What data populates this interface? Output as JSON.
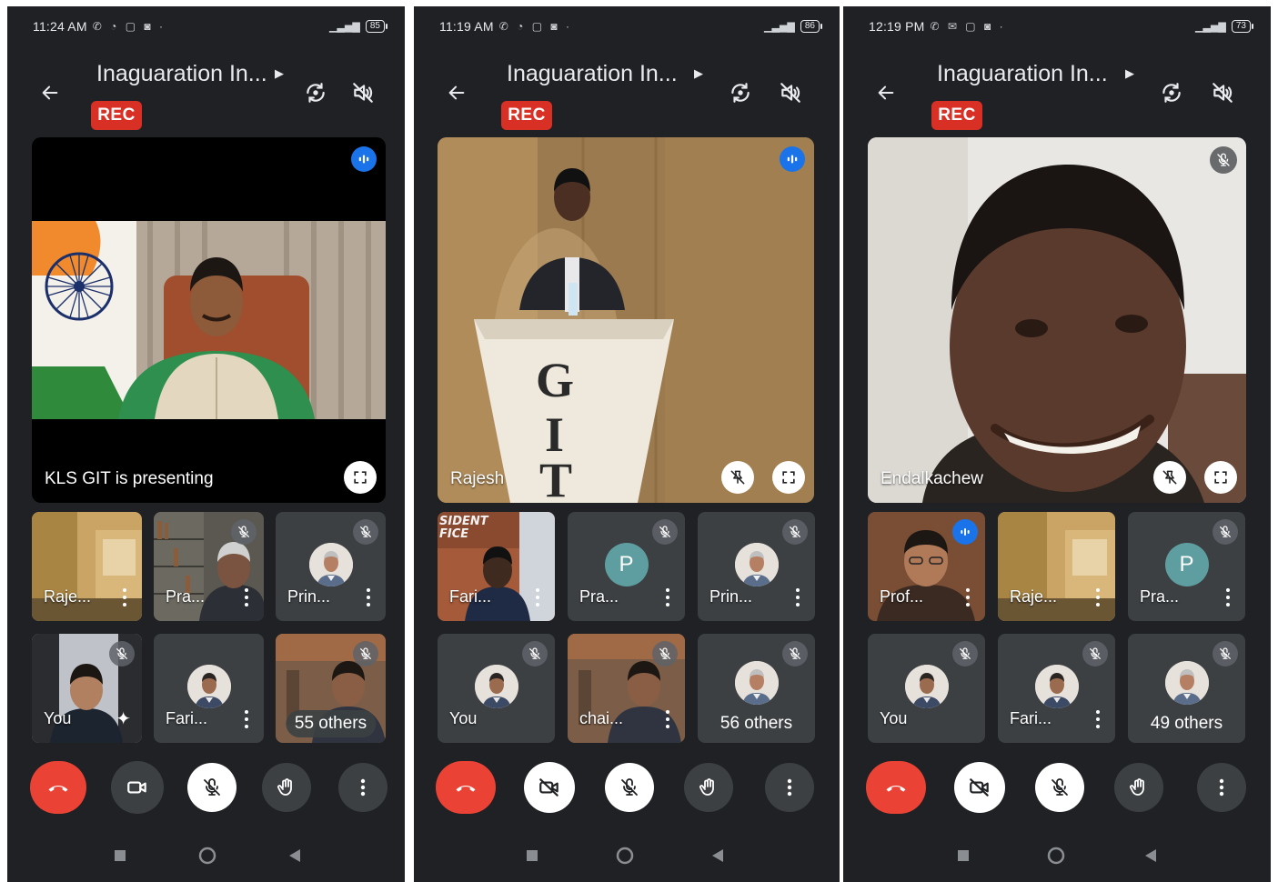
{
  "meeting": {
    "title": "Inaguaration In...",
    "rec_label": "REC"
  },
  "phones": [
    {
      "status": {
        "time": "11:24 AM",
        "battery": "85"
      },
      "main": {
        "label": "KLS GIT is presenting"
      },
      "tiles": [
        {
          "label": "Raje..."
        },
        {
          "label": "Pra..."
        },
        {
          "label": "Prin..."
        },
        {
          "label": "You"
        },
        {
          "label": "Fari..."
        },
        {
          "label": "55 others"
        }
      ]
    },
    {
      "status": {
        "time": "11:19 AM",
        "battery": "86"
      },
      "main": {
        "label": "Rajesh"
      },
      "tiles": [
        {
          "label": "Fari..."
        },
        {
          "label": "Pra...",
          "avatar_letter": "P"
        },
        {
          "label": "Prin..."
        },
        {
          "label": "You"
        },
        {
          "label": "chai..."
        },
        {
          "label": "56 others"
        }
      ]
    },
    {
      "status": {
        "time": "12:19 PM",
        "battery": "73"
      },
      "main": {
        "label": "Endalkachew"
      },
      "tiles": [
        {
          "label": "Prof..."
        },
        {
          "label": "Raje..."
        },
        {
          "label": "Pra...",
          "avatar_letter": "P"
        },
        {
          "label": "You"
        },
        {
          "label": "Fari..."
        },
        {
          "label": "49 others"
        }
      ]
    }
  ],
  "colors": {
    "background": "#202124",
    "tile": "#3c4043",
    "rec": "#d93025",
    "end_call": "#ea4335",
    "speaking": "#1a73e8",
    "avatar_p": "#5f9ea0"
  }
}
